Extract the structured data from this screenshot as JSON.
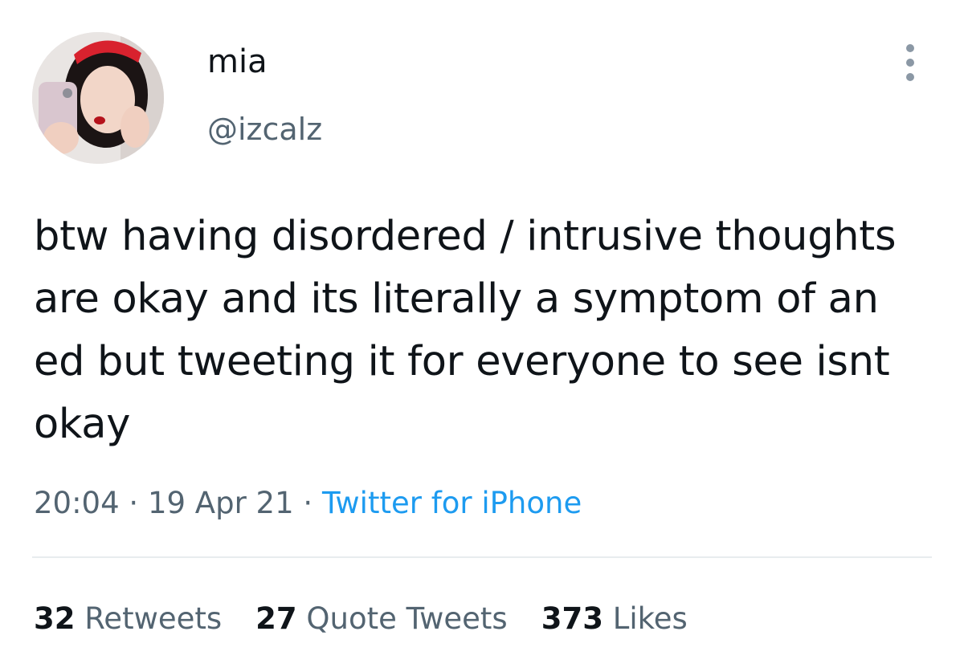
{
  "author": {
    "display_name": "mia",
    "handle": "@izcalz",
    "avatar_icon": "profile-photo"
  },
  "tweet": {
    "text": "btw having disordered / intrusive thoughts are okay and its literally a symptom of an ed but tweeting it for everyone to see isnt okay",
    "time": "20:04",
    "date": "19 Apr 21",
    "separator": "·",
    "source": "Twitter for iPhone"
  },
  "stats": {
    "retweets": {
      "count": "32",
      "label": "Retweets"
    },
    "quote_tweets": {
      "count": "27",
      "label": "Quote Tweets"
    },
    "likes": {
      "count": "373",
      "label": "Likes"
    }
  },
  "colors": {
    "text_primary": "#0f1419",
    "text_secondary": "#536471",
    "link": "#1d9bf0",
    "divider": "#e8ecee"
  },
  "menu": {
    "icon": "more-vertical-icon"
  }
}
